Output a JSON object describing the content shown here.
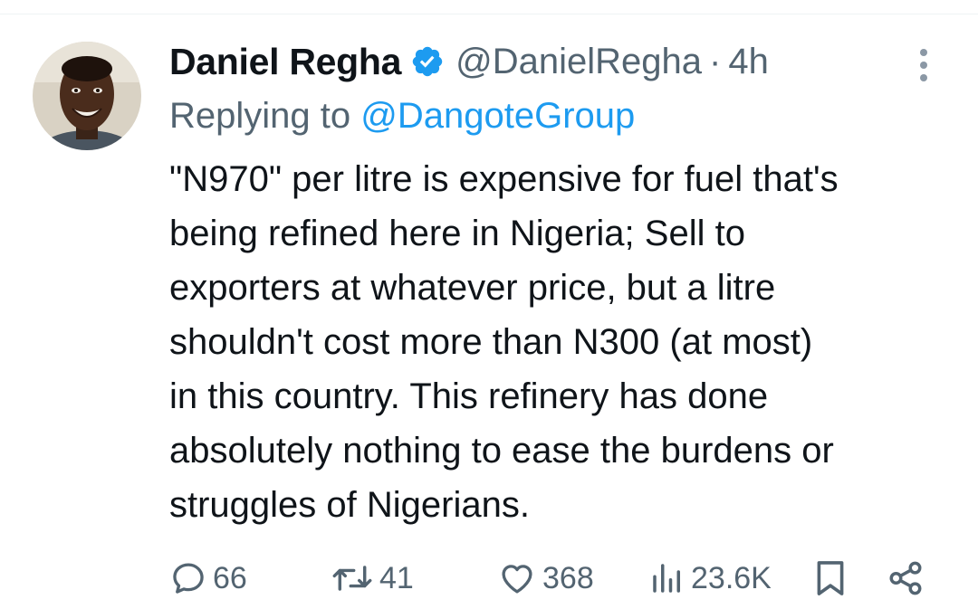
{
  "colors": {
    "text": "#0f1419",
    "secondary": "#536471",
    "accent": "#1d9bf0"
  },
  "author": {
    "display_name": "Daniel Regha",
    "handle": "@DanielRegha",
    "separator": "·",
    "time": "4h",
    "verified_icon": "verified-badge-icon",
    "avatar_icon": "avatar"
  },
  "reply": {
    "prefix": "Replying to",
    "mention": "@DangoteGroup"
  },
  "tweet": {
    "text": "\"N970\" per litre is expensive for fuel that's\nbeing refined here in Nigeria; Sell to\nexporters at whatever price, but a litre\nshouldn't cost more than N300 (at most)\nin this country. This refinery has done\nabsolutely nothing to ease the burdens or\nstruggles of Nigerians."
  },
  "actions": {
    "replies": "66",
    "reposts": "41",
    "likes": "368",
    "views": "23.6K"
  }
}
